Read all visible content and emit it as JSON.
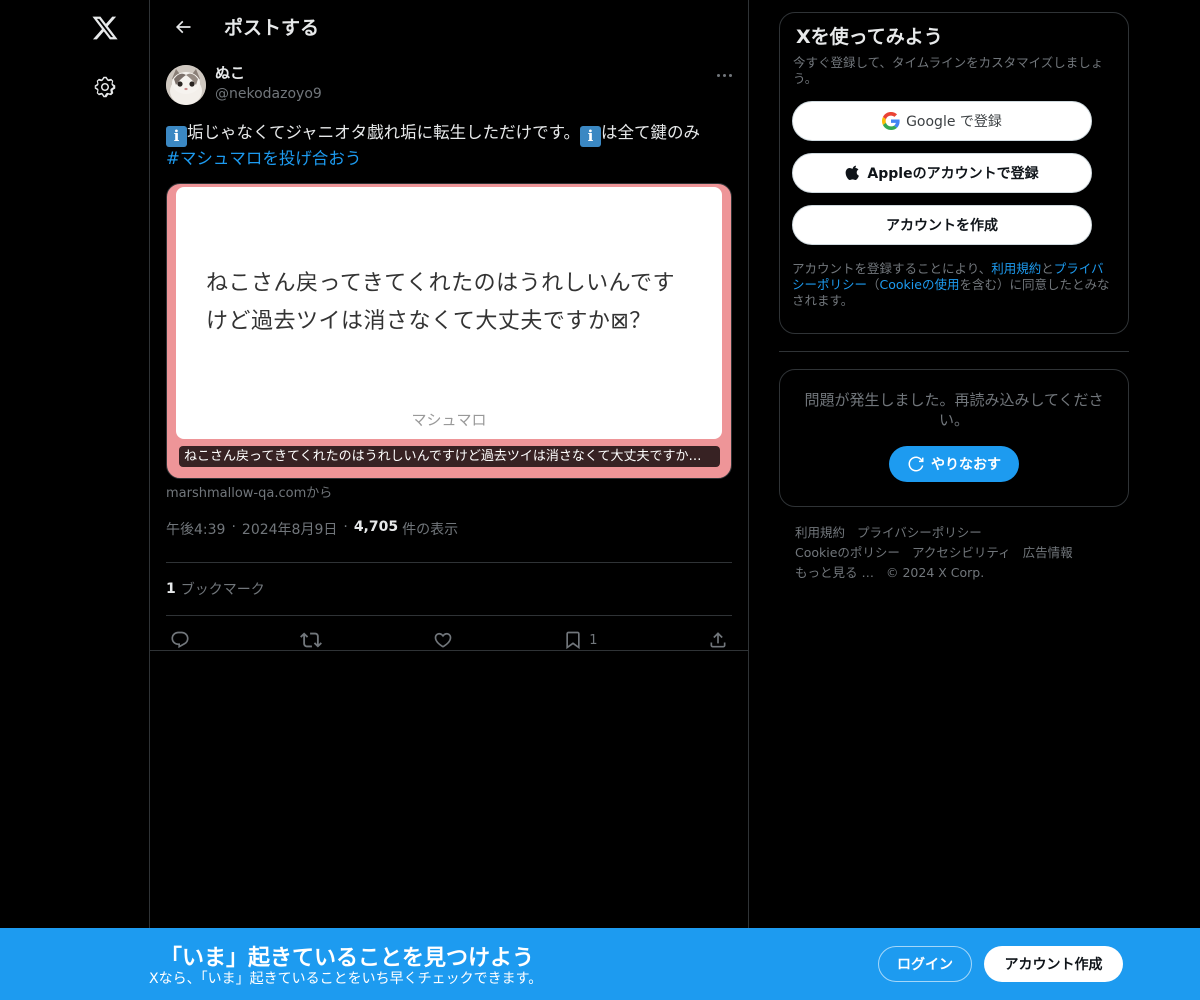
{
  "nav": {
    "logo_icon": "x-logo-icon",
    "settings_icon": "gear-icon"
  },
  "header": {
    "title": "ポストする",
    "back_icon": "arrow-left-icon"
  },
  "post": {
    "author_name": "ぬこ",
    "author_handle": "@nekodazoyo9",
    "more_icon": "more-dots-icon",
    "text_part1": "垢じゃなくてジャニオタ戯れ垢に転生しただけです。",
    "text_part2": "は全て鍵のみ",
    "info_emoji": "i",
    "hashtag": "#マシュマロを投げ合おう",
    "card": {
      "question_line1": "ねこさん戻ってきてくれたのはうれしいんです",
      "question_line2": "けど過去ツイは消さなくて大丈夫ですか⊠？",
      "brand": "マシュマロ",
      "caption": "ねこさん戻ってきてくれたのはうれしいんですけど過去ツイは消さなくて大丈夫ですか…",
      "source": "marshmallow-qa.comから",
      "background": "#ee9598"
    },
    "time": "午後4:39",
    "date": "2024年8月9日",
    "views": "4,705",
    "views_label": "件の表示",
    "bookmark_count": "1",
    "bookmark_label": "ブックマーク",
    "actions": {
      "reply_icon": "reply-icon",
      "repost_icon": "repost-icon",
      "like_icon": "heart-icon",
      "bookmark_icon": "bookmark-icon",
      "bookmark_count": "1",
      "share_icon": "share-icon"
    }
  },
  "sidebar": {
    "signup_title": "Xを使ってみよう",
    "signup_sub": "今すぐ登録して、タイムラインをカスタマイズしましょう。",
    "google_label": "Google で登録",
    "apple_label": "Appleのアカウントで登録",
    "create_label": "アカウントを作成",
    "legal_1": "アカウントを登録することにより、",
    "legal_terms": "利用規約",
    "legal_and": "と",
    "legal_privacy": "プライバシーポリシー",
    "legal_2": "（",
    "legal_cookie": "Cookieの使用",
    "legal_3": "を含む）に同意したとみなされます。",
    "error_text": "問題が発生しました。再読み込みしてください。",
    "retry_label": "やりなおす",
    "footer": {
      "terms": "利用規約",
      "privacy": "プライバシーポリシー",
      "cookie": "Cookieのポリシー",
      "accessibility": "アクセシビリティ",
      "ads": "広告情報",
      "more": "もっと見る …",
      "copyright": "© 2024 X Corp."
    }
  },
  "bottombar": {
    "title": "「いま」起きていることを見つけよう",
    "subtitle": "Xなら、「いま」起きていることをいち早くチェックできます。",
    "login": "ログイン",
    "create": "アカウント作成",
    "color": "#1d9bf0"
  }
}
